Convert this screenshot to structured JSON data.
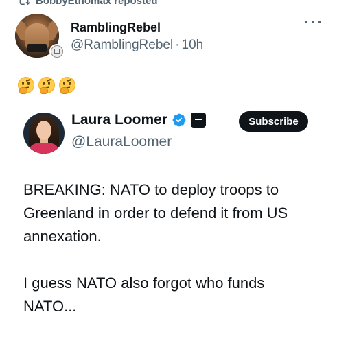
{
  "repost": {
    "label": "BobbyEthomax reposted"
  },
  "outer_post": {
    "display_name": "RamblingRebel",
    "handle": "@RamblingRebel",
    "separator": "·",
    "time": "10h",
    "emoji_count": 3,
    "emoji": "🤔",
    "more_icon": "more-horizontal-icon"
  },
  "quoted_post": {
    "display_name": "Laura Loomer",
    "handle": "@LauraLoomer",
    "subscribe_label": "Subscribe",
    "verified_color": "#1d9bf0",
    "paragraphs": [
      "BREAKING: NATO to deploy troops to Greenland in order to defend it from US annexation.",
      "I guess NATO also forgot who funds NATO..."
    ]
  },
  "colors": {
    "text_primary": "#0f1419",
    "text_secondary": "#536471",
    "button_bg": "#0f1419",
    "verified": "#1d9bf0"
  }
}
